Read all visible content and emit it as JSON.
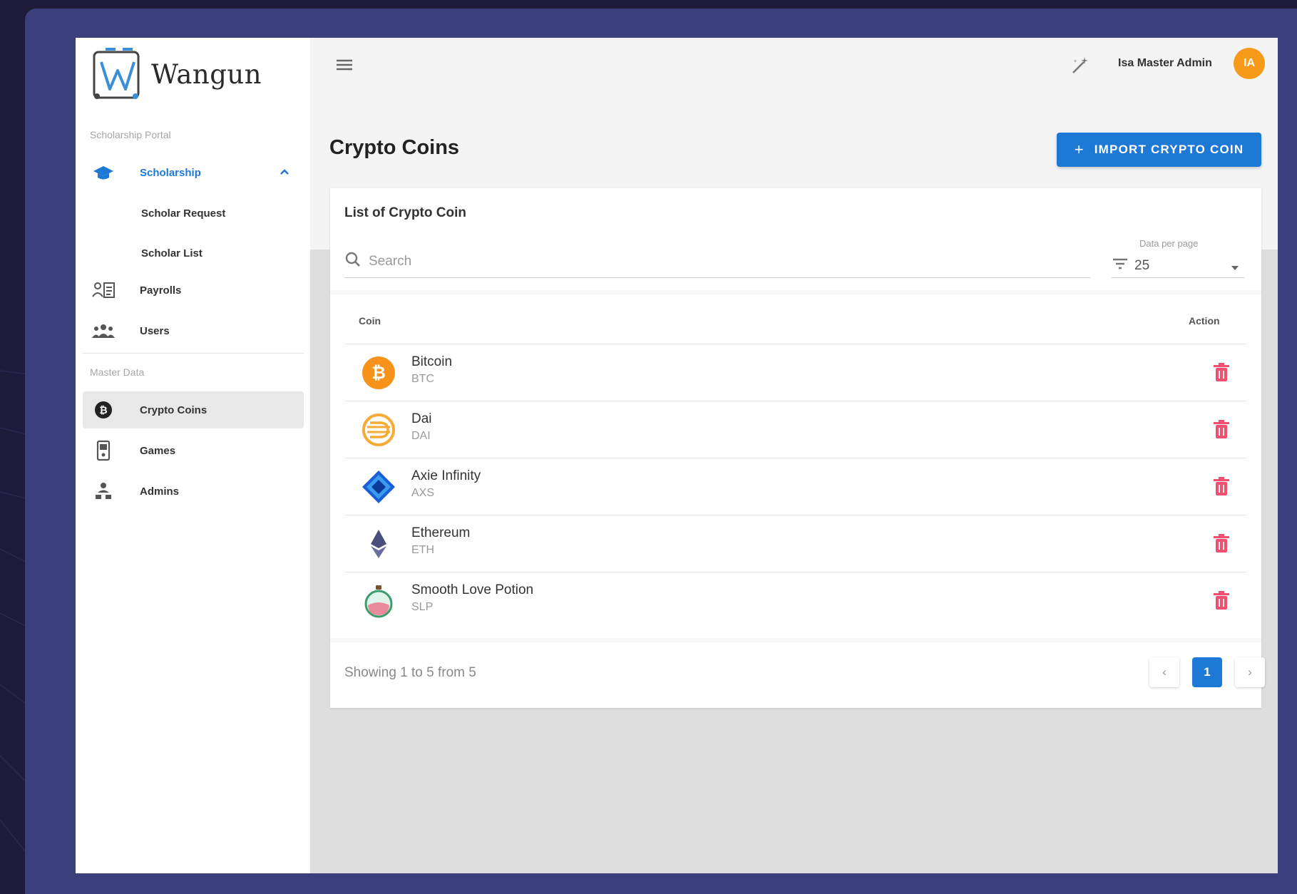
{
  "brand": {
    "name": "Wangun"
  },
  "sidebar": {
    "section_scholarship": "Scholarship Portal",
    "section_master": "Master Data",
    "scholarship": {
      "label": "Scholarship",
      "icon": "graduation-cap-icon"
    },
    "sub_items": [
      {
        "label": "Scholar Request"
      },
      {
        "label": "Scholar List"
      }
    ],
    "items": [
      {
        "label": "Payrolls",
        "icon": "payroll-icon"
      },
      {
        "label": "Users",
        "icon": "users-icon"
      },
      {
        "label": "Crypto Coins",
        "icon": "coin-icon"
      },
      {
        "label": "Games",
        "icon": "game-icon"
      },
      {
        "label": "Admins",
        "icon": "admin-icon"
      }
    ]
  },
  "topbar": {
    "user_name": "Isa Master Admin",
    "avatar_initials": "IA"
  },
  "page": {
    "title": "Crypto Coins",
    "import_label": "IMPORT CRYPTO COIN"
  },
  "card": {
    "title": "List of Crypto Coin",
    "search_placeholder": "Search",
    "per_page_label": "Data per page",
    "per_page_value": "25",
    "col_coin": "Coin",
    "col_action": "Action",
    "rows": [
      {
        "name": "Bitcoin",
        "symbol": "BTC",
        "color": "#f7931a"
      },
      {
        "name": "Dai",
        "symbol": "DAI",
        "color": "#f5ac37"
      },
      {
        "name": "Axie Infinity",
        "symbol": "AXS",
        "color": "#1a5fd6"
      },
      {
        "name": "Ethereum",
        "symbol": "ETH",
        "color": "#4a4e7a"
      },
      {
        "name": "Smooth Love Potion",
        "symbol": "SLP",
        "color": "#e98a9c"
      }
    ],
    "showing": "Showing 1 to 5 from 5",
    "current_page": "1",
    "prev_label": "‹",
    "next_label": "›"
  },
  "colors": {
    "primary": "#1e78d6",
    "danger": "#f0506e",
    "avatar": "#f79a1a",
    "frame": "#3b3f7c"
  }
}
